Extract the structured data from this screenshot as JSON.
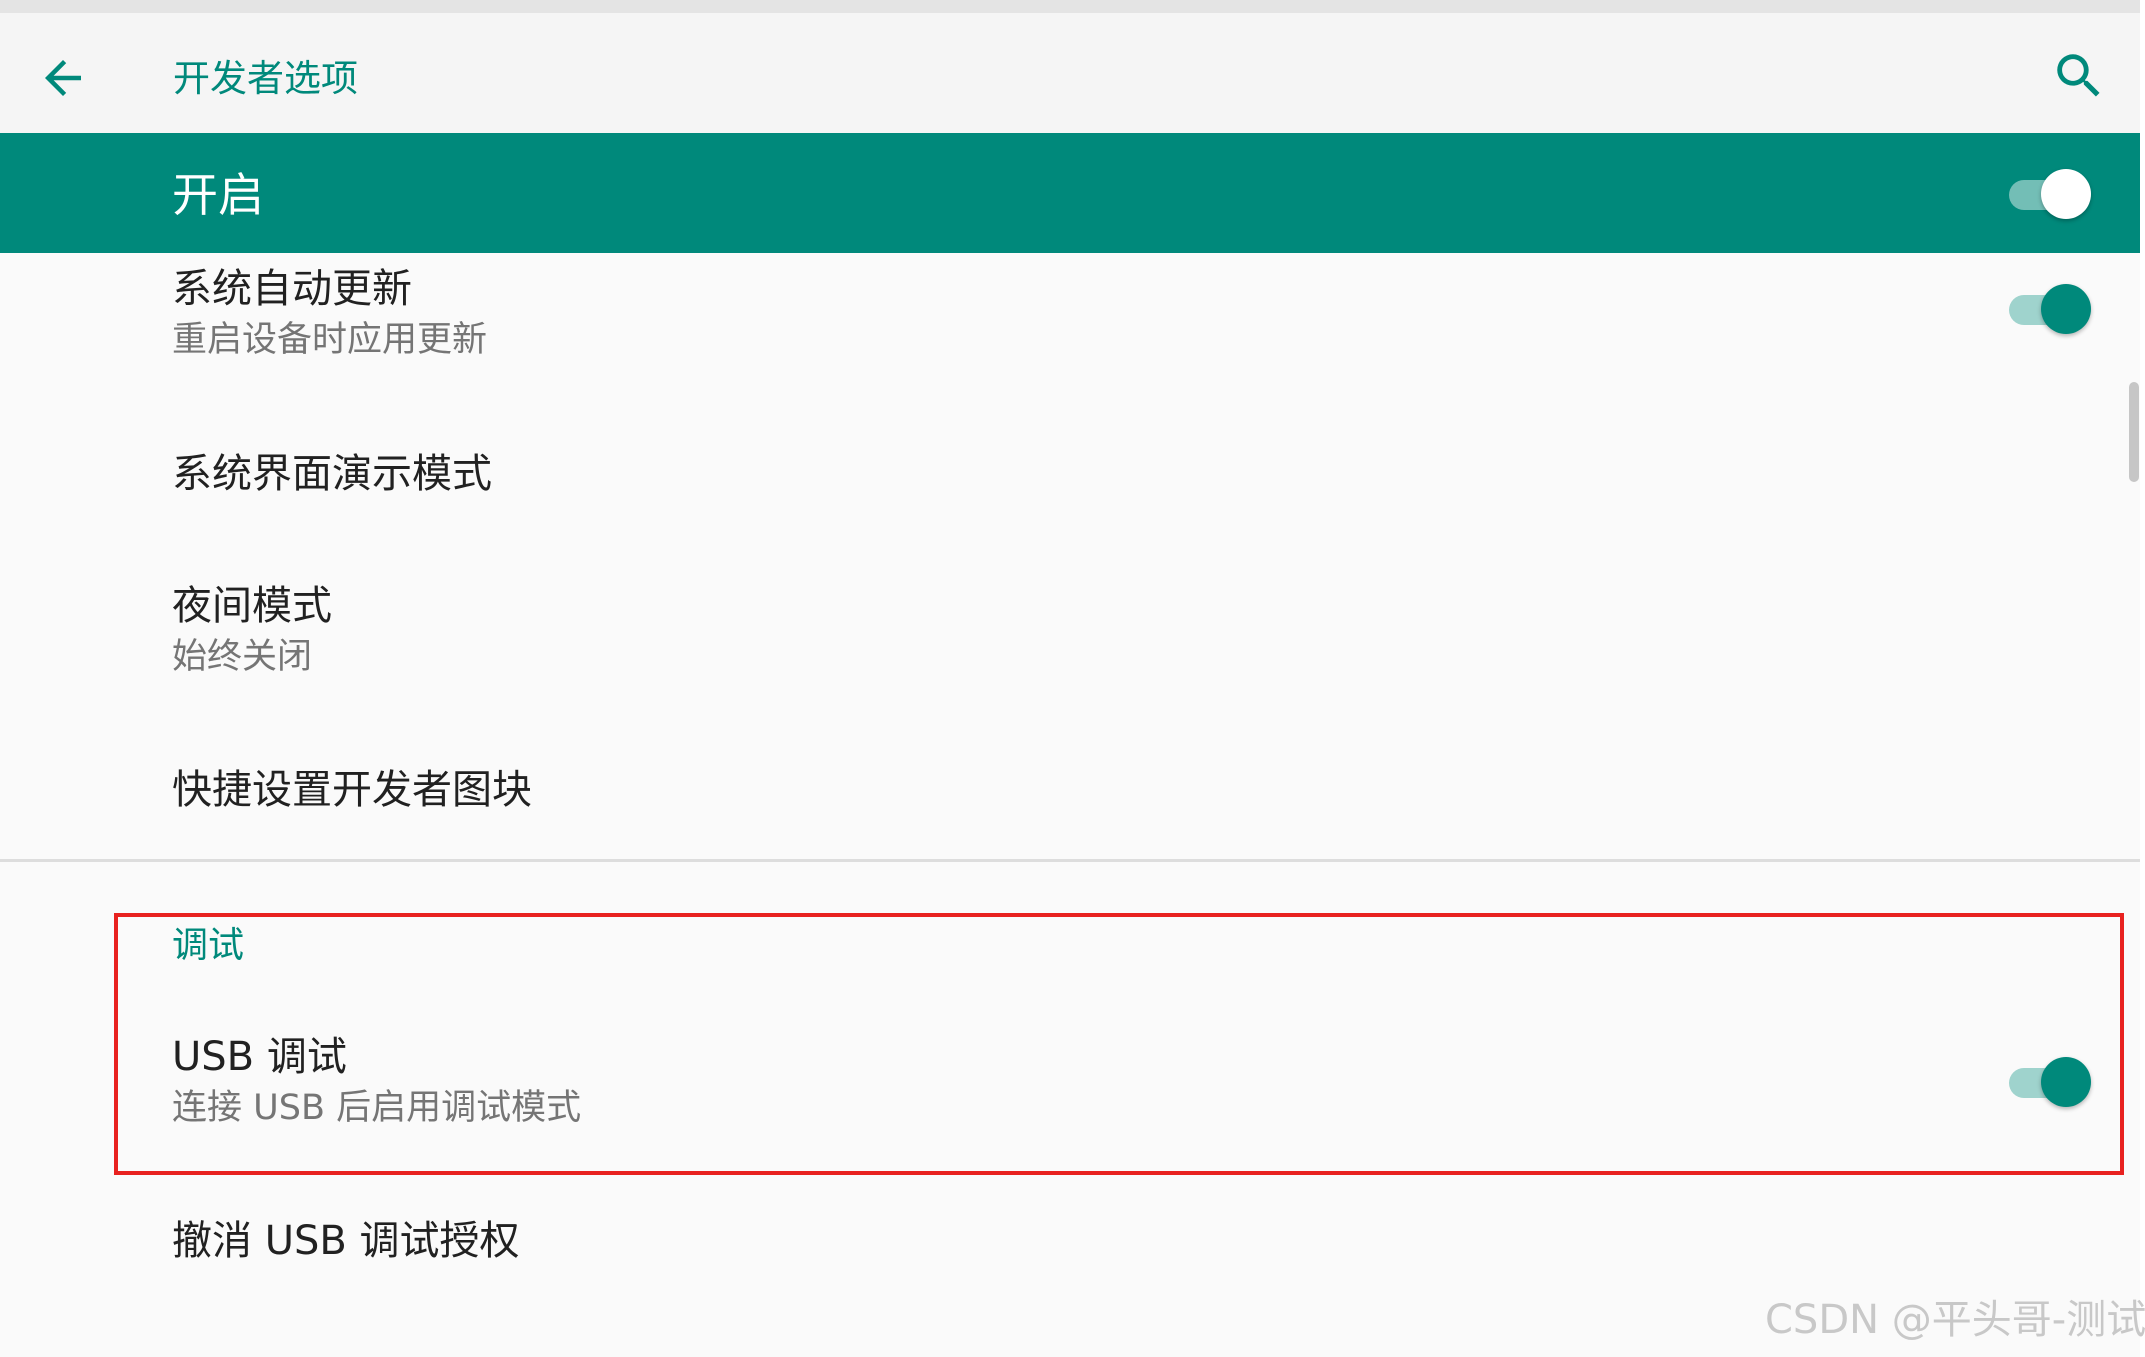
{
  "colors": {
    "accent": "#00897b",
    "accent_light": "#9fd3cd",
    "highlight_border": "#e8211f"
  },
  "toolbar": {
    "back_icon": "arrow-back-icon",
    "title": "开发者选项",
    "search_icon": "search-icon"
  },
  "master_switch": {
    "label": "开启",
    "checked": true
  },
  "prefs": {
    "auto_update": {
      "title": "系统自动更新",
      "summary": "重启设备时应用更新",
      "checked": true
    },
    "demo_mode": {
      "title": "系统界面演示模式"
    },
    "night_mode": {
      "title": "夜间模式",
      "summary": "始终关闭"
    },
    "quick_tiles": {
      "title": "快捷设置开发者图块"
    },
    "debug_category": {
      "title": "调试"
    },
    "usb_debugging": {
      "title": "USB 调试",
      "summary": "连接 USB 后启用调试模式",
      "checked": true
    },
    "revoke_usb": {
      "title": "撤消 USB 调试授权"
    }
  },
  "watermark": "CSDN @平头哥-测试"
}
